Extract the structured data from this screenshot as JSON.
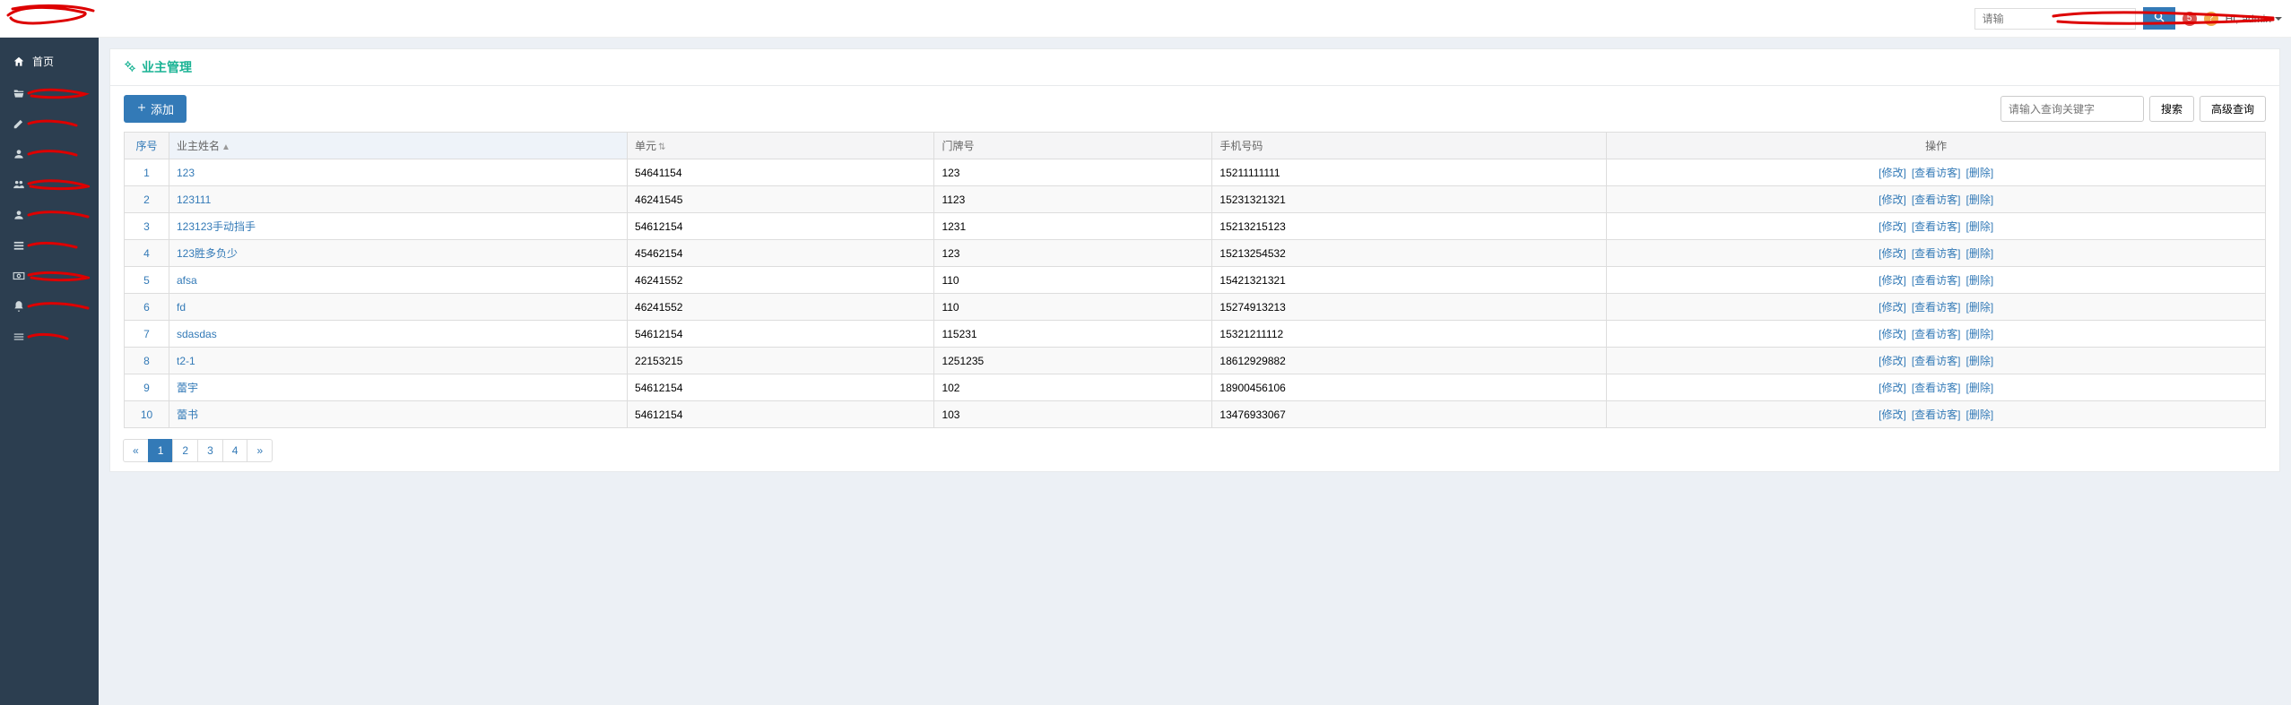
{
  "topbar": {
    "search_placeholder": "请输",
    "badge_red": "5",
    "badge_yellow": "?",
    "user_prefix": "Hi,",
    "user_name": "admin"
  },
  "sidebar": {
    "home": "首页"
  },
  "page": {
    "title": "业主管理",
    "add_label": "添加",
    "query_placeholder": "请输入查询关键字",
    "search_label": "搜索",
    "adv_search_label": "高级查询"
  },
  "table": {
    "headers": {
      "index": "序号",
      "name": "业主姓名",
      "unit": "单元",
      "door": "门牌号",
      "phone": "手机号码",
      "action": "操作"
    },
    "actions": {
      "edit": "[修改]",
      "view": "[查看访客]",
      "delete": "[删除]"
    },
    "rows": [
      {
        "idx": "1",
        "name": "123",
        "unit": "54641154",
        "door": "123",
        "phone": "15211111111"
      },
      {
        "idx": "2",
        "name": "123111",
        "unit": "46241545",
        "door": "1123",
        "phone": "15231321321"
      },
      {
        "idx": "3",
        "name": "123123手动挡手",
        "unit": "54612154",
        "door": "1231",
        "phone": "15213215123"
      },
      {
        "idx": "4",
        "name": "123胜多负少",
        "unit": "45462154",
        "door": "123",
        "phone": "15213254532"
      },
      {
        "idx": "5",
        "name": "afsa",
        "unit": "46241552",
        "door": "110",
        "phone": "15421321321"
      },
      {
        "idx": "6",
        "name": "fd",
        "unit": "46241552",
        "door": "110",
        "phone": "15274913213"
      },
      {
        "idx": "7",
        "name": "sdasdas",
        "unit": "54612154",
        "door": "115231",
        "phone": "15321211112"
      },
      {
        "idx": "8",
        "name": "t2-1",
        "unit": "22153215",
        "door": "1251235",
        "phone": "18612929882"
      },
      {
        "idx": "9",
        "name": "蕾宇",
        "unit": "54612154",
        "door": "102",
        "phone": "18900456106"
      },
      {
        "idx": "10",
        "name": "蕾书",
        "unit": "54612154",
        "door": "103",
        "phone": "13476933067"
      }
    ]
  },
  "pagination": {
    "prev": "«",
    "pages": [
      "1",
      "2",
      "3",
      "4"
    ],
    "next": "»",
    "active": "1"
  }
}
